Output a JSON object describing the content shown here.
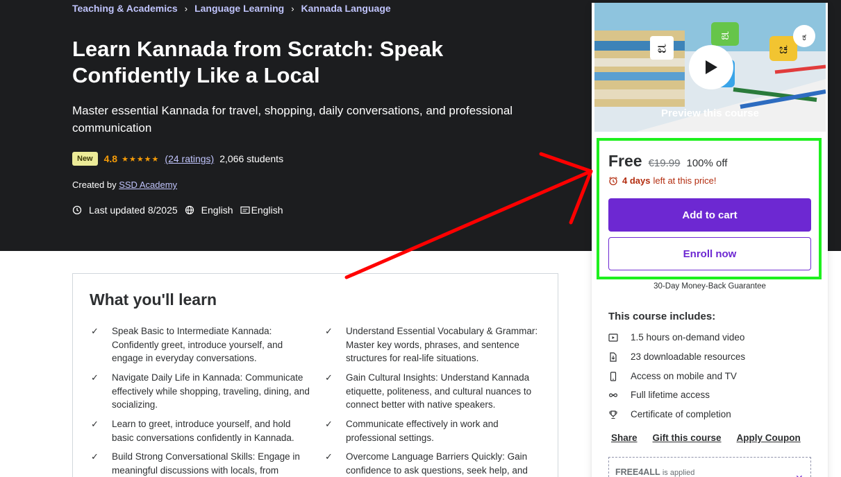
{
  "breadcrumb": [
    "Teaching & Academics",
    "Language Learning",
    "Kannada Language"
  ],
  "course": {
    "title": "Learn Kannada from Scratch: Speak Confidently Like a Local",
    "subtitle": "Master essential Kannada for travel, shopping, daily conversations, and professional communication",
    "badge": "New",
    "rating": "4.8",
    "stars": "★★★★★",
    "ratings_count": "(24 ratings)",
    "students": "2,066 students",
    "created_by_label": "Created by",
    "author": "SSD Academy",
    "last_updated": "Last updated 8/2025",
    "language": "English",
    "captions": "English"
  },
  "learn": {
    "title": "What you'll learn",
    "items": [
      "Speak Basic to Intermediate Kannada: Confidently greet, introduce yourself, and engage in everyday conversations.",
      "Understand Essential Vocabulary & Grammar: Master key words, phrases, and sentence structures for real-life situations.",
      "Navigate Daily Life in Kannada: Communicate effectively while shopping, traveling, dining, and socializing.",
      "Gain Cultural Insights: Understand Kannada etiquette, politeness, and cultural nuances to connect better with native speakers.",
      "Learn to greet, introduce yourself, and hold basic conversations confidently in Kannada.",
      "Communicate effectively in work and professional settings.",
      "Build Strong Conversational Skills: Engage in meaningful discussions with locals, from",
      "Overcome Language Barriers Quickly: Gain confidence to ask questions, seek help, and"
    ]
  },
  "sidebar": {
    "preview_label": "Preview this course",
    "price_now": "Free",
    "price_old": "€19.99",
    "discount": "100% off",
    "deadline_bold": "4 days",
    "deadline_rest": "left at this price!",
    "add_to_cart": "Add to cart",
    "enroll_now": "Enroll now",
    "guarantee": "30-Day Money-Back Guarantee",
    "includes_title": "This course includes:",
    "includes": [
      {
        "icon": "video-icon",
        "text": "1.5 hours on-demand video"
      },
      {
        "icon": "download-file-icon",
        "text": "23 downloadable resources"
      },
      {
        "icon": "mobile-icon",
        "text": "Access on mobile and TV"
      },
      {
        "icon": "infinity-icon",
        "text": "Full lifetime access"
      },
      {
        "icon": "trophy-icon",
        "text": "Certificate of completion"
      }
    ],
    "links": [
      "Share",
      "Gift this course",
      "Apply Coupon"
    ],
    "coupon_code": "FREE4ALL",
    "coupon_status": "is applied"
  },
  "colors": {
    "hero_bg": "#1c1d1f",
    "accent_purple": "#6d28d2",
    "rating_orange": "#f69c08",
    "annotation_red": "#ff0000",
    "annotation_green": "#1ef01e"
  }
}
